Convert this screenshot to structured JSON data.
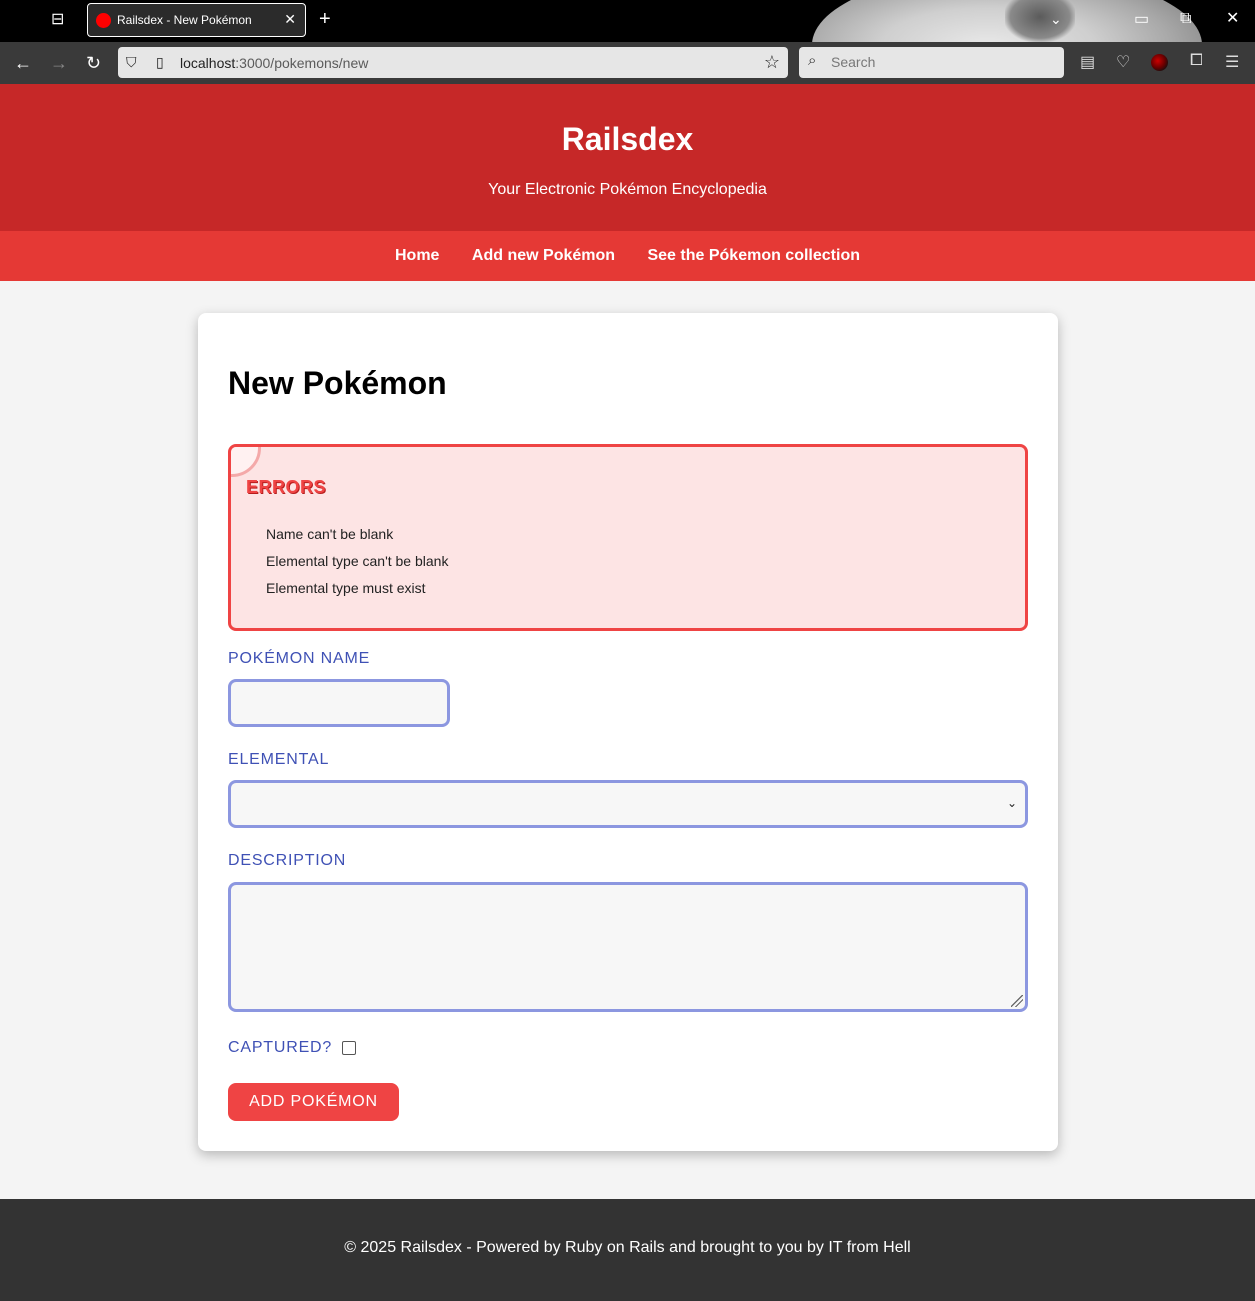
{
  "browser": {
    "tab_title": "Railsdex - New Pokémon",
    "url_host": "localhost",
    "url_path": ":3000/pokemons/new",
    "search_placeholder": "Search"
  },
  "site": {
    "title": "Railsdex",
    "tagline": "Your Electronic Pokémon Encyclopedia",
    "nav": [
      "Home",
      "Add new Pokémon",
      "See the Pókemon collection"
    ]
  },
  "form": {
    "heading": "New Pokémon",
    "errors_title": "ERRORS",
    "errors": [
      "Name can't be blank",
      "Elemental type can't be blank",
      "Elemental type must exist"
    ],
    "name_label": "POKÉMON NAME",
    "name_value": "",
    "elemental_label": "ELEMENTAL",
    "elemental_value": "",
    "description_label": "DESCRIPTION",
    "description_value": "",
    "captured_label": "CAPTURED?",
    "captured": false,
    "submit_label": "ADD POKÉMON"
  },
  "footer": {
    "text": "© 2025 Railsdex - Powered by Ruby on Rails and brought to you by IT from Hell"
  },
  "colors": {
    "header_bg": "#c62828",
    "nav_bg": "#e53935",
    "accent_red": "#ef4444",
    "label_blue": "#3f51b5",
    "field_border": "#8c97e0",
    "footer_bg": "#333333"
  }
}
